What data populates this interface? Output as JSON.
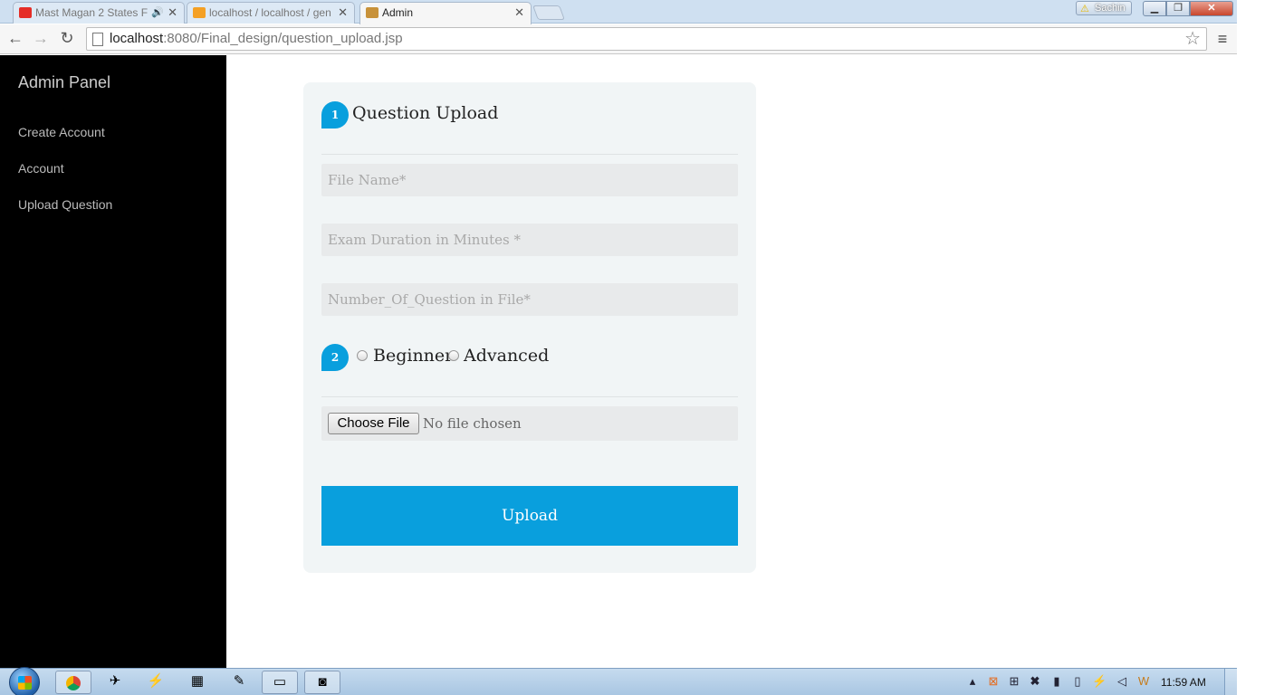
{
  "browser": {
    "tabs": [
      {
        "label": "Mast Magan 2 States F",
        "favicon_color": "#e52d27",
        "audio": true
      },
      {
        "label": "localhost / localhost / gen",
        "favicon_color": "#f4a024",
        "favicon_text": "PMA"
      },
      {
        "label": "Admin",
        "favicon_color": "#c8923a",
        "active": true
      }
    ],
    "user_badge": "Sachin",
    "url_host": "localhost",
    "url_rest": ":8080/Final_design/question_upload.jsp"
  },
  "sidebar": {
    "title": "Admin Panel",
    "items": [
      {
        "label": "Create Account"
      },
      {
        "label": "Account"
      },
      {
        "label": "Upload Question"
      }
    ]
  },
  "form": {
    "step1": "1",
    "heading": "Question Upload",
    "fields": [
      {
        "placeholder": "File Name*"
      },
      {
        "placeholder": "Exam Duration in Minutes *"
      },
      {
        "placeholder": "Number_Of_Question in File*"
      }
    ],
    "step2": "2",
    "level_options": [
      {
        "label": "Beginner",
        "checked": false
      },
      {
        "label": "Advanced",
        "checked": false
      }
    ],
    "file_button": "Choose File",
    "file_status": "No file chosen",
    "submit": "Upload"
  },
  "taskbar": {
    "clock": "11:59 AM",
    "apps": [
      "chrome-icon",
      "network-tool-icon",
      "flash-icon",
      "calculator-icon",
      "notepad-icon",
      "explorer-folder-icon",
      "capture-tool-icon"
    ]
  },
  "colors": {
    "accent": "#099fdd",
    "sidebar_bg": "#000000",
    "card_bg": "#f1f5f6"
  }
}
